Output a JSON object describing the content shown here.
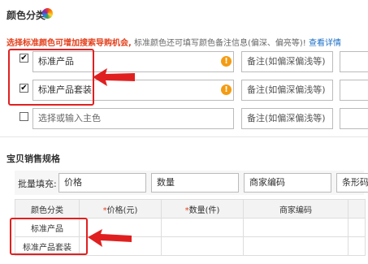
{
  "color_section": {
    "title": "颜色分类",
    "hint_red": "选择标准颜色可增加搜索导购机会,",
    "hint_gray": "标准颜色还可填写颜色备注信息(偏深、偏亮等)!",
    "hint_link": "查看详情",
    "rows": [
      {
        "checked": true,
        "value": "标准产品",
        "note_placeholder": "备注(如偏深偏浅等)",
        "has_warning": true
      },
      {
        "checked": true,
        "value": "标准产品套装",
        "note_placeholder": "备注(如偏深偏浅等)",
        "has_warning": true
      },
      {
        "checked": false,
        "value": "选择或输入主色",
        "note_placeholder": "备注(如偏深偏浅等)",
        "has_warning": false
      }
    ],
    "checkbox_checked_glyph": "✔",
    "warning_glyph": "!"
  },
  "spec_section": {
    "title": "宝贝销售规格",
    "bulk_label": "批量填充:",
    "bulk_fields": [
      "价格",
      "数量",
      "商家编码",
      "条形码"
    ],
    "table": {
      "headers": [
        {
          "label": "颜色分类",
          "required": false
        },
        {
          "label": "价格(元)",
          "required": true
        },
        {
          "label": "数量(件)",
          "required": true
        },
        {
          "label": "商家编码",
          "required": false
        },
        {
          "label": "",
          "required": false
        }
      ],
      "required_mark": "*",
      "rows": [
        {
          "color": "标准产品"
        },
        {
          "color": "标准产品套装"
        }
      ]
    }
  },
  "colors": {
    "accent_red": "#e02020",
    "hint_red": "#e3401c",
    "link_blue": "#1a6ec5",
    "warning_orange": "#f39c12"
  }
}
